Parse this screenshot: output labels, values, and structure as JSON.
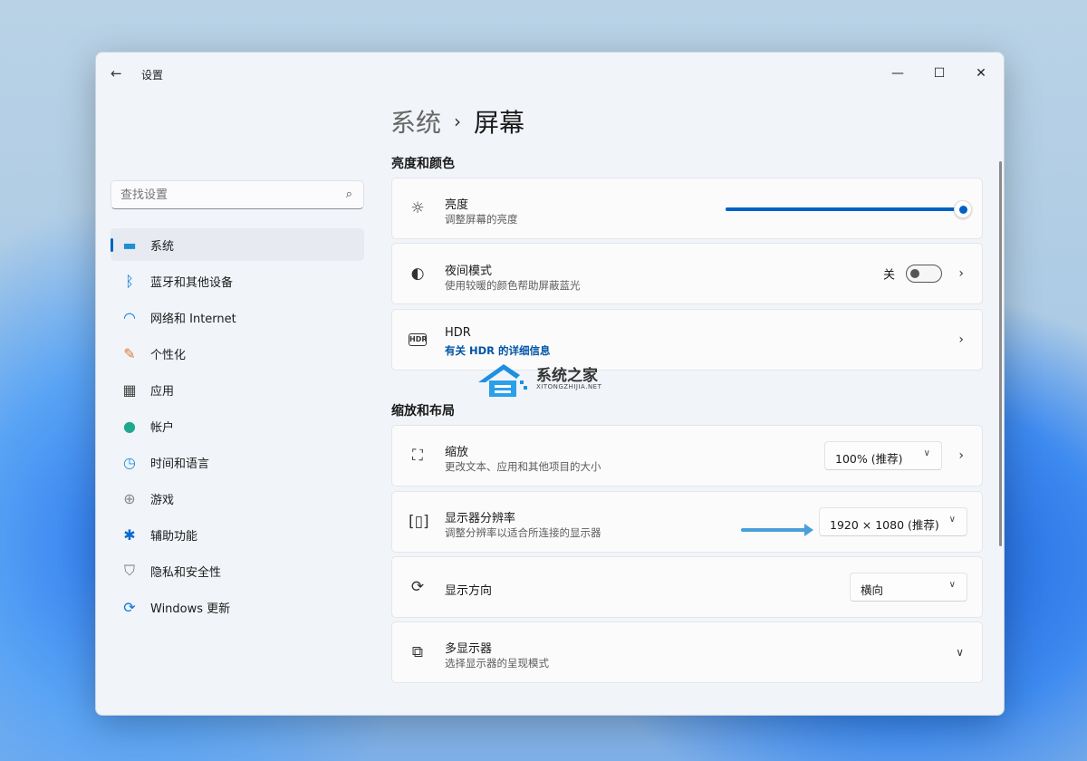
{
  "window": {
    "title": "设置",
    "back_icon": "arrow-left-icon",
    "minimize_icon": "minimize-icon",
    "maximize_icon": "maximize-icon",
    "close_icon": "close-icon"
  },
  "search": {
    "placeholder": "查找设置",
    "icon": "search-icon"
  },
  "sidebar": {
    "items": [
      {
        "label": "系统",
        "icon": "monitor-icon",
        "color": "#1e8fd0",
        "active": true
      },
      {
        "label": "蓝牙和其他设备",
        "icon": "bluetooth-icon",
        "color": "#0078d4"
      },
      {
        "label": "网络和 Internet",
        "icon": "wifi-icon",
        "color": "#0a7ae0"
      },
      {
        "label": "个性化",
        "icon": "brush-icon",
        "color": "#e07a30"
      },
      {
        "label": "应用",
        "icon": "apps-icon",
        "color": "#444"
      },
      {
        "label": "帐户",
        "icon": "person-icon",
        "color": "#1fa88c"
      },
      {
        "label": "时间和语言",
        "icon": "globe-clock-icon",
        "color": "#1e90d8"
      },
      {
        "label": "游戏",
        "icon": "gamepad-icon",
        "color": "#888"
      },
      {
        "label": "辅助功能",
        "icon": "accessibility-icon",
        "color": "#0a6ad0"
      },
      {
        "label": "隐私和安全性",
        "icon": "shield-icon",
        "color": "#777"
      },
      {
        "label": "Windows 更新",
        "icon": "update-icon",
        "color": "#0a78d8"
      }
    ]
  },
  "breadcrumb": {
    "parent": "系统",
    "current": "屏幕"
  },
  "sections": {
    "brightness_color": "亮度和颜色",
    "scale_layout": "缩放和布局"
  },
  "cards": {
    "brightness": {
      "title": "亮度",
      "subtitle": "调整屏幕的亮度",
      "icon": "sun-icon",
      "value_percent": 100
    },
    "night": {
      "title": "夜间模式",
      "subtitle": "使用较暖的颜色帮助屏蔽蓝光",
      "icon": "night-light-icon",
      "state": "关",
      "on": false
    },
    "hdr": {
      "title": "HDR",
      "subtitle": "有关 HDR 的详细信息",
      "icon": "hdr-icon"
    },
    "scale": {
      "title": "缩放",
      "subtitle": "更改文本、应用和其他项目的大小",
      "icon": "scale-icon",
      "value": "100% (推荐)"
    },
    "resolution": {
      "title": "显示器分辨率",
      "subtitle": "调整分辨率以适合所连接的显示器",
      "icon": "resolution-icon",
      "value": "1920 × 1080 (推荐)"
    },
    "orientation": {
      "title": "显示方向",
      "icon": "rotate-icon",
      "value": "横向"
    },
    "multi": {
      "title": "多显示器",
      "subtitle": "选择显示器的呈现模式",
      "icon": "multi-monitor-icon"
    }
  },
  "watermark": {
    "cn": "系统之家",
    "en": "XITONGZHIJIA.NET"
  },
  "colors": {
    "accent": "#0062c4",
    "annotation_arrow": "#4a9fd8"
  }
}
